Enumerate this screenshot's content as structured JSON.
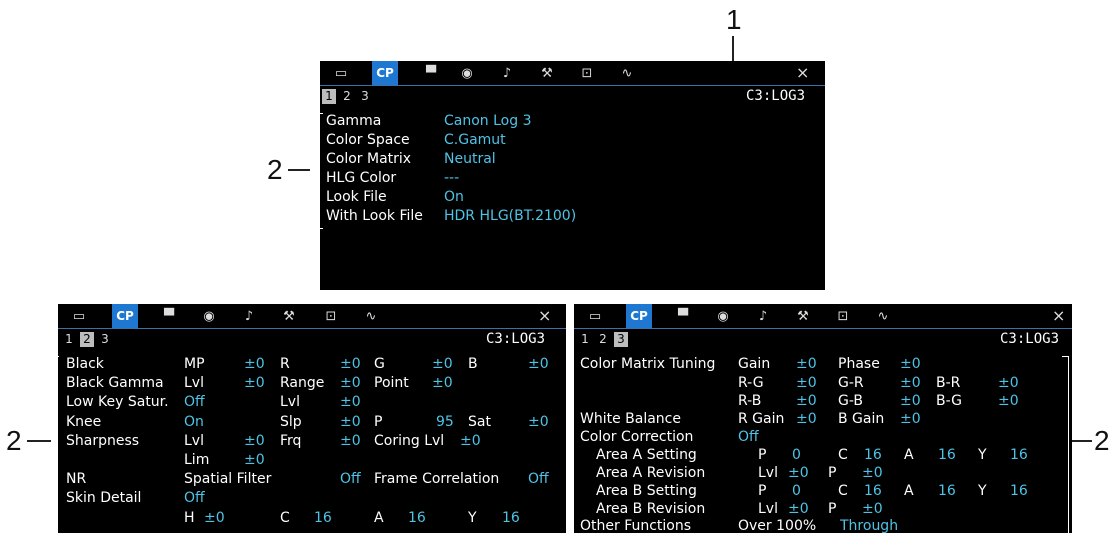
{
  "callouts": {
    "one": "1",
    "two_top": "2",
    "two_left": "2",
    "two_right": "2"
  },
  "tabs": [
    "frame-icon",
    "CP",
    "film-camera-icon",
    "lens-icon",
    "audio-icon",
    "wrench-icon",
    "recording-icon",
    "waveform-icon"
  ],
  "cp_label": "CP",
  "close_label": "×",
  "pages": [
    "1",
    "2",
    "3"
  ],
  "code": "C3:LOG3",
  "screen1": {
    "labels": [
      "Gamma",
      "Color Space",
      "Color Matrix",
      "HLG Color",
      "Look File",
      "With Look File"
    ],
    "values": [
      "Canon Log 3",
      "C.Gamut",
      "Neutral",
      "---",
      "On",
      "HDR HLG(BT.2100)"
    ]
  },
  "screen2": {
    "black": [
      "Black",
      "MP",
      "±0",
      "R",
      "±0",
      "G",
      "±0",
      "B",
      "±0"
    ],
    "black_gamma": [
      "Black Gamma",
      "Lvl",
      "±0",
      "Range",
      "±0",
      "Point",
      "±0"
    ],
    "low_key": [
      "Low Key Satur.",
      "Off",
      "Lvl",
      "±0"
    ],
    "knee": [
      "Knee",
      "On",
      "Slp",
      "±0",
      "P",
      "95",
      "Sat",
      "±0"
    ],
    "sharpness": [
      "Sharpness",
      "Lvl",
      "±0",
      "Frq",
      "±0",
      "Coring Lvl",
      "±0"
    ],
    "lim": [
      "Lim",
      "±0"
    ],
    "nr": [
      "NR",
      "Spatial Filter",
      "Off",
      "Frame Correlation",
      "Off"
    ],
    "skin": [
      "Skin Detail",
      "Off"
    ],
    "hcay": [
      "H",
      "±0",
      "C",
      "16",
      "A",
      "16",
      "Y",
      "16"
    ]
  },
  "screen3": {
    "cmt": [
      "Color Matrix Tuning",
      "Gain",
      "±0",
      "Phase",
      "±0"
    ],
    "rg": [
      "R-G",
      "±0",
      "G-R",
      "±0",
      "B-R",
      "±0"
    ],
    "rb": [
      "R-B",
      "±0",
      "G-B",
      "±0",
      "B-G",
      "±0"
    ],
    "wb": [
      "White Balance",
      "R Gain",
      "±0",
      "B Gain",
      "±0"
    ],
    "cc": [
      "Color Correction",
      "Off"
    ],
    "aas": [
      "Area A Setting",
      "P",
      "0",
      "C",
      "16",
      "A",
      "16",
      "Y",
      "16"
    ],
    "aar": [
      "Area A Revision",
      "Lvl",
      "±0",
      "P",
      "±0"
    ],
    "abs": [
      "Area B Setting",
      "P",
      "0",
      "C",
      "16",
      "A",
      "16",
      "Y",
      "16"
    ],
    "abr": [
      "Area B Revision",
      "Lvl",
      "±0",
      "P",
      "±0"
    ],
    "of": [
      "Other Functions",
      "Over 100%",
      "Through"
    ]
  }
}
